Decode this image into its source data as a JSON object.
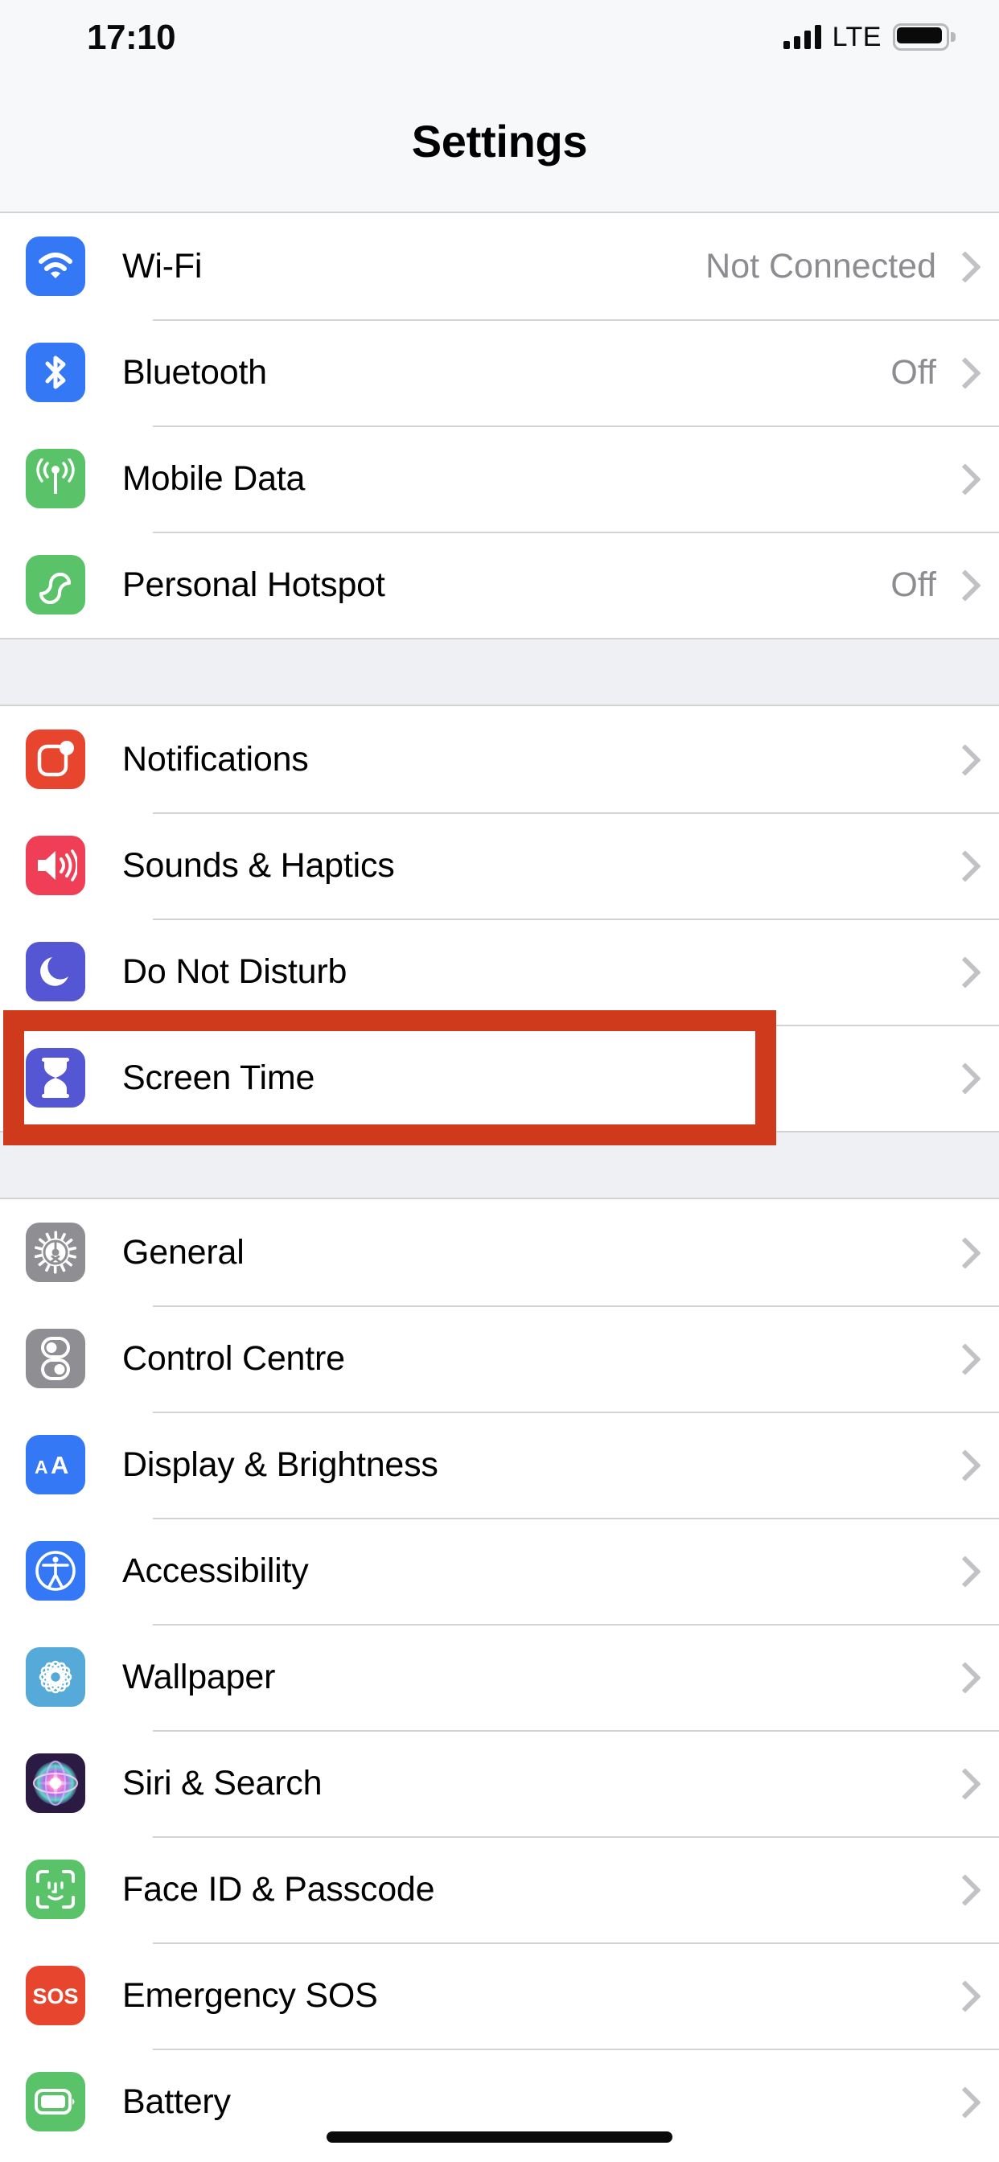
{
  "status_bar": {
    "time": "17:10",
    "network_label": "LTE",
    "signal_bars": 4,
    "battery_full": true
  },
  "header": {
    "title": "Settings"
  },
  "groups": [
    {
      "id": "connectivity",
      "rows": [
        {
          "icon": "wifi-icon",
          "label": "Wi-Fi",
          "value": "Not Connected",
          "color": "#3478f6"
        },
        {
          "icon": "bluetooth-icon",
          "label": "Bluetooth",
          "value": "Off",
          "color": "#3478f6"
        },
        {
          "icon": "mobile-data-icon",
          "label": "Mobile Data",
          "value": "",
          "color": "#5ac268"
        },
        {
          "icon": "personal-hotspot-icon",
          "label": "Personal Hotspot",
          "value": "Off",
          "color": "#5ac268"
        }
      ]
    },
    {
      "id": "alerts",
      "rows": [
        {
          "icon": "notifications-icon",
          "label": "Notifications",
          "value": "",
          "color": "#e8452f"
        },
        {
          "icon": "sounds-icon",
          "label": "Sounds & Haptics",
          "value": "",
          "color": "#ef3e55"
        },
        {
          "icon": "do-not-disturb-icon",
          "label": "Do Not Disturb",
          "value": "",
          "color": "#5556d3"
        },
        {
          "icon": "screen-time-icon",
          "label": "Screen Time",
          "value": "",
          "color": "#5556d3"
        }
      ]
    },
    {
      "id": "system",
      "rows": [
        {
          "icon": "general-icon",
          "label": "General",
          "value": "",
          "color": "#8e8e93"
        },
        {
          "icon": "control-centre-icon",
          "label": "Control Centre",
          "value": "",
          "color": "#8e8e93"
        },
        {
          "icon": "display-icon",
          "label": "Display & Brightness",
          "value": "",
          "color": "#3478f6"
        },
        {
          "icon": "accessibility-icon",
          "label": "Accessibility",
          "value": "",
          "color": "#3478f6"
        },
        {
          "icon": "wallpaper-icon",
          "label": "Wallpaper",
          "value": "",
          "color": "#56aada"
        },
        {
          "icon": "siri-icon",
          "label": "Siri & Search",
          "value": "",
          "color": "#2b1b42"
        },
        {
          "icon": "face-id-icon",
          "label": "Face ID & Passcode",
          "value": "",
          "color": "#5ac268"
        },
        {
          "icon": "emergency-sos-icon",
          "label": "Emergency SOS",
          "value": "",
          "color": "#e8452f"
        },
        {
          "icon": "battery-icon",
          "label": "Battery",
          "value": "",
          "color": "#5ac268"
        }
      ]
    }
  ],
  "annotation": {
    "highlight_color": "#cf3a1c",
    "highlight_target": "Screen Time"
  }
}
